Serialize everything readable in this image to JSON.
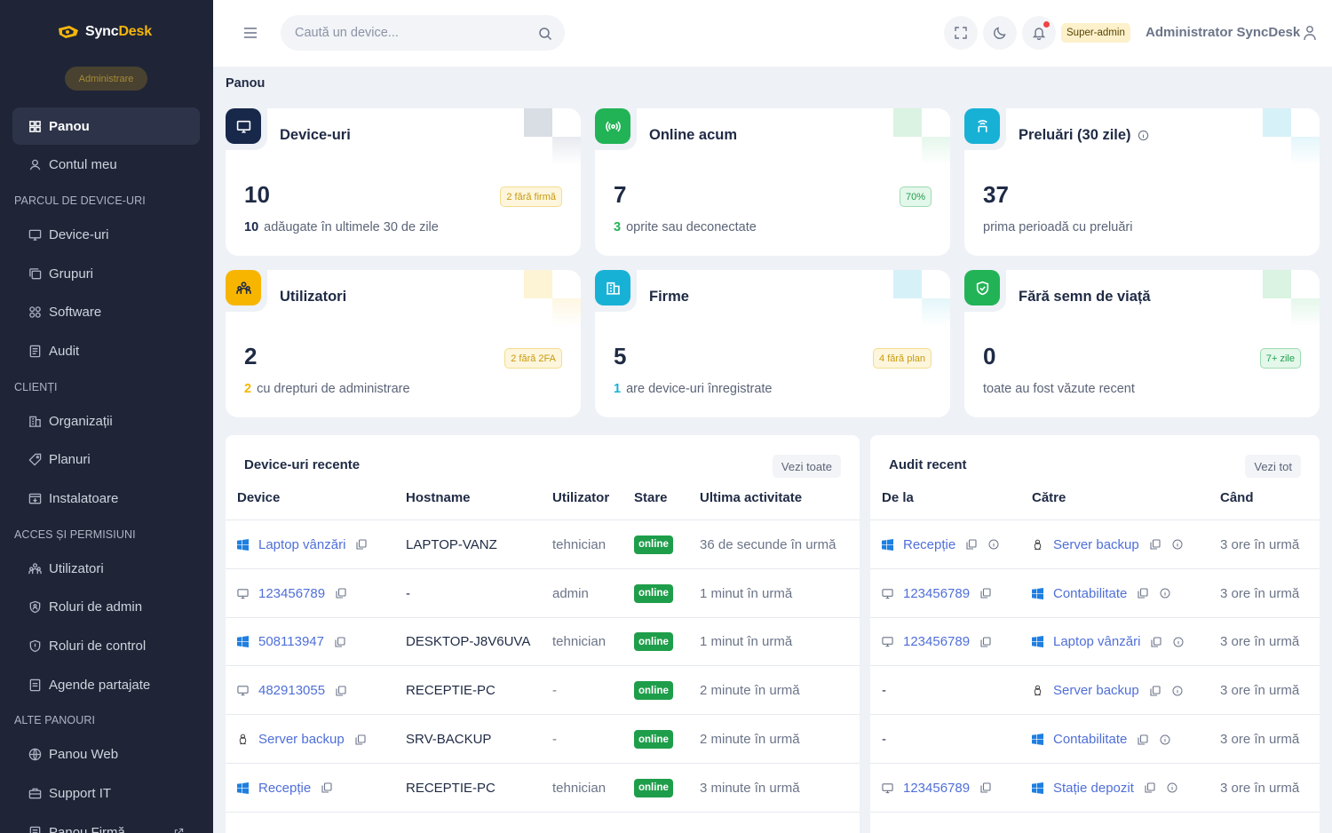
{
  "brand": {
    "name_a": "Sync",
    "name_b": "Desk",
    "tag": "Administrare"
  },
  "nav": {
    "main": [
      {
        "label": "Panou"
      },
      {
        "label": "Contul meu"
      }
    ],
    "sec1_title": "PARCUL DE DEVICE-URI",
    "sec1": [
      {
        "label": "Device-uri"
      },
      {
        "label": "Grupuri"
      },
      {
        "label": "Software"
      },
      {
        "label": "Audit"
      }
    ],
    "sec2_title": "CLIENȚI",
    "sec2": [
      {
        "label": "Organizații"
      },
      {
        "label": "Planuri"
      },
      {
        "label": "Instalatoare"
      }
    ],
    "sec3_title": "ACCES ȘI PERMISIUNI",
    "sec3": [
      {
        "label": "Utilizatori"
      },
      {
        "label": "Roluri de admin"
      },
      {
        "label": "Roluri de control"
      },
      {
        "label": "Agende partajate"
      }
    ],
    "sec4_title": "ALTE PANOURI",
    "sec4": [
      {
        "label": "Panou Web"
      },
      {
        "label": "Support IT"
      },
      {
        "label": "Panou Firmă"
      }
    ]
  },
  "topbar": {
    "search_placeholder": "Caută un device...",
    "role": "Super-admin",
    "user": "Administrator SyncDesk"
  },
  "breadcrumb": "Panou",
  "cards": [
    {
      "title": "Device-uri",
      "value": "10",
      "badge": "2 fără firmă",
      "sub_num": "10",
      "sub_text": "adăugate în ultimele 30 de zile",
      "color": "#17284a"
    },
    {
      "title": "Online acum",
      "value": "7",
      "badge": "70%",
      "sub_num": "3",
      "sub_text": "oprite sau deconectate",
      "color": "#22b356"
    },
    {
      "title": "Preluări (30 zile)",
      "value": "37",
      "badge": "",
      "sub_num": "",
      "sub_text": "prima perioadă cu preluări",
      "color": "#18b1d6"
    },
    {
      "title": "Utilizatori",
      "value": "2",
      "badge": "2 fără 2FA",
      "sub_num": "2",
      "sub_text": "cu drepturi de administrare",
      "color": "#f7b500"
    },
    {
      "title": "Firme",
      "value": "5",
      "badge": "4 fără plan",
      "sub_num": "1",
      "sub_text": "are device-uri înregistrate",
      "color": "#18b1d6"
    },
    {
      "title": "Fără semn de viață",
      "value": "0",
      "badge": "7+ zile",
      "sub_num": "",
      "sub_text": "toate au fost văzute recent",
      "color": "#22b356"
    }
  ],
  "recent_devices": {
    "title": "Device-uri recente",
    "see_all": "Vezi toate",
    "columns": [
      "Device",
      "Hostname",
      "Utilizator",
      "Stare",
      "Ultima activitate"
    ],
    "rows": [
      {
        "os": "windows",
        "device": "Laptop vânzări",
        "hostname": "LAPTOP-VANZ",
        "user": "tehnician",
        "status": "online",
        "last": "36 de secunde în urmă"
      },
      {
        "os": "monitor",
        "device": "123456789",
        "hostname": "-",
        "user": "admin",
        "status": "online",
        "last": "1 minut în urmă"
      },
      {
        "os": "windows",
        "device": "508113947",
        "hostname": "DESKTOP-J8V6UVA",
        "user": "tehnician",
        "status": "online",
        "last": "1 minut în urmă"
      },
      {
        "os": "monitor",
        "device": "482913055",
        "hostname": "RECEPTIE-PC",
        "user": "-",
        "status": "online",
        "last": "2 minute în urmă"
      },
      {
        "os": "linux",
        "device": "Server backup",
        "hostname": "SRV-BACKUP",
        "user": "-",
        "status": "online",
        "last": "2 minute în urmă"
      },
      {
        "os": "windows",
        "device": "Recepție",
        "hostname": "RECEPTIE-PC",
        "user": "tehnician",
        "status": "online",
        "last": "3 minute în urmă"
      }
    ]
  },
  "recent_audit": {
    "title": "Audit recent",
    "see_all": "Vezi tot",
    "columns": [
      "De la",
      "Către",
      "Când"
    ],
    "rows": [
      {
        "from_os": "windows",
        "from": "Recepție",
        "to_os": "linux",
        "to": "Server backup",
        "when": "3 ore în urmă"
      },
      {
        "from_os": "monitor",
        "from": "123456789",
        "to_os": "windows",
        "to": "Contabilitate",
        "when": "3 ore în urmă"
      },
      {
        "from_os": "monitor",
        "from": "123456789",
        "to_os": "windows",
        "to": "Laptop vânzări",
        "when": "3 ore în urmă"
      },
      {
        "from_os": "",
        "from": "-",
        "to_os": "linux",
        "to": "Server backup",
        "when": "3 ore în urmă"
      },
      {
        "from_os": "",
        "from": "-",
        "to_os": "windows",
        "to": "Contabilitate",
        "when": "3 ore în urmă"
      },
      {
        "from_os": "monitor",
        "from": "123456789",
        "to_os": "windows",
        "to": "Stație depozit",
        "when": "3 ore în urmă"
      }
    ]
  }
}
